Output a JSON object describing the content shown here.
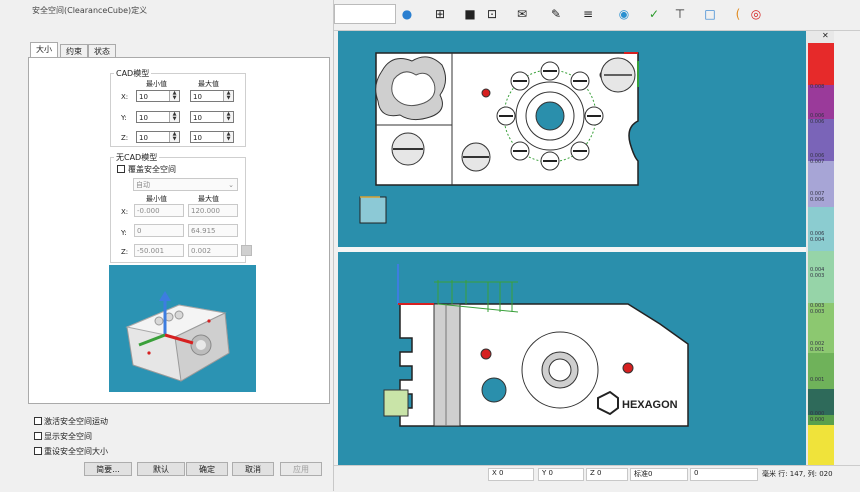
{
  "dialog": {
    "title": "安全空间(ClearanceCube)定义",
    "tabs": [
      "大小",
      "约束",
      "状态"
    ],
    "cad_group": {
      "title": "CAD模型",
      "min_header": "最小值",
      "max_header": "最大值",
      "rows": [
        {
          "axis": "X:",
          "min": "10",
          "max": "10"
        },
        {
          "axis": "Y:",
          "min": "10",
          "max": "10"
        },
        {
          "axis": "Z:",
          "min": "10",
          "max": "10"
        }
      ]
    },
    "nocad_group": {
      "title": "无CAD模型",
      "override_label": "覆盖安全空间",
      "mode_value": "自动",
      "min_header": "最小值",
      "max_header": "最大值",
      "rows": [
        {
          "axis": "X:",
          "min": "-0.000",
          "max": "120.000"
        },
        {
          "axis": "Y:",
          "min": "0",
          "max": "64.915"
        },
        {
          "axis": "Z:",
          "min": "-50.001",
          "max": "0.002"
        }
      ]
    },
    "checkboxes": [
      "激活安全空间运动",
      "显示安全空间",
      "重设安全空间大小"
    ],
    "buttons": {
      "browse": "简要...",
      "default": "默认",
      "ok": "确定",
      "cancel": "取消",
      "apply": "应用"
    }
  },
  "colorbar": {
    "labels": [
      "0.008",
      "0.006",
      "0.006",
      "0.006",
      "0.007",
      "0.007",
      "0.006",
      "0.006",
      "0.004",
      "0.004",
      "0.003",
      "0.003",
      "0.003",
      "0.002",
      "0.001",
      "0.001",
      "0.000",
      "0.000"
    ],
    "colors": [
      "#e8e8e8",
      "#e62a2a",
      "#9a2a9a",
      "#6e4bb0",
      "#8e86c2",
      "#a9a6d4",
      "#7ec4cc",
      "#7ec9b8",
      "#8fce9a",
      "#8cc67e",
      "#86c266",
      "#82c05c",
      "#5aa04c",
      "#2e6a5a",
      "#5aa04c",
      "#8fce6a",
      "#f0e33a"
    ]
  },
  "status": {
    "x_label": "X 0",
    "y_label": "Y 0",
    "z_label": "Z 0",
    "std_label": "标准0",
    "field": "0",
    "units": "毫米 行: 147, 列: 020"
  },
  "logo_text": "HEXAGON",
  "colors": {
    "view_bg": "#2a8fac",
    "part_fill": "#ffffff",
    "accent_green": "#39a03a",
    "accent_red": "#d62020"
  }
}
